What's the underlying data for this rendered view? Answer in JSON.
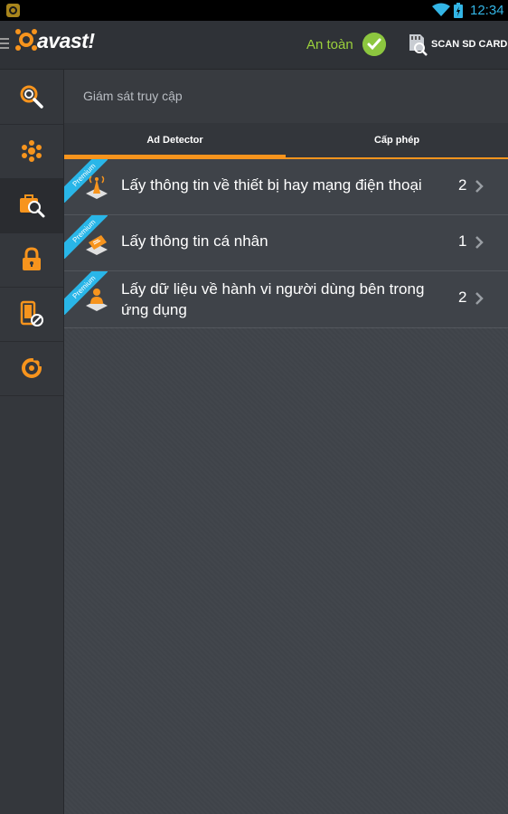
{
  "status_bar": {
    "time": "12:34"
  },
  "app_bar": {
    "logo_text": "avast!",
    "status_text": "An toàn",
    "scan_label": "SCAN SD CARD"
  },
  "sidebar": {
    "items": [
      {
        "icon": "scan-icon"
      },
      {
        "icon": "shield-nodes-icon"
      },
      {
        "icon": "privacy-advisor-icon",
        "active": true
      },
      {
        "icon": "lock-icon"
      },
      {
        "icon": "phone-block-icon"
      },
      {
        "icon": "anti-theft-icon"
      }
    ]
  },
  "main": {
    "section_title": "Giám sát truy cập",
    "tabs": [
      {
        "label": "Ad Detector",
        "selected": true
      },
      {
        "label": "Cấp phép",
        "selected": false
      }
    ],
    "rows": [
      {
        "badge": "Premium",
        "label": "Lấy thông tin về thiết bị hay mạng điện thoại",
        "count": "2",
        "icon": "signal-tower-icon"
      },
      {
        "badge": "Premium",
        "label": "Lấy thông tin cá nhân",
        "count": "1",
        "icon": "id-card-icon"
      },
      {
        "badge": "Premium",
        "label": "Lấy dữ liệu về hành vi người dùng bên trong ứng dụng",
        "count": "2",
        "icon": "user-icon"
      }
    ]
  },
  "colors": {
    "accent": "#f7941d",
    "status_ok": "#8cc63f",
    "badge": "#29b6e8"
  }
}
